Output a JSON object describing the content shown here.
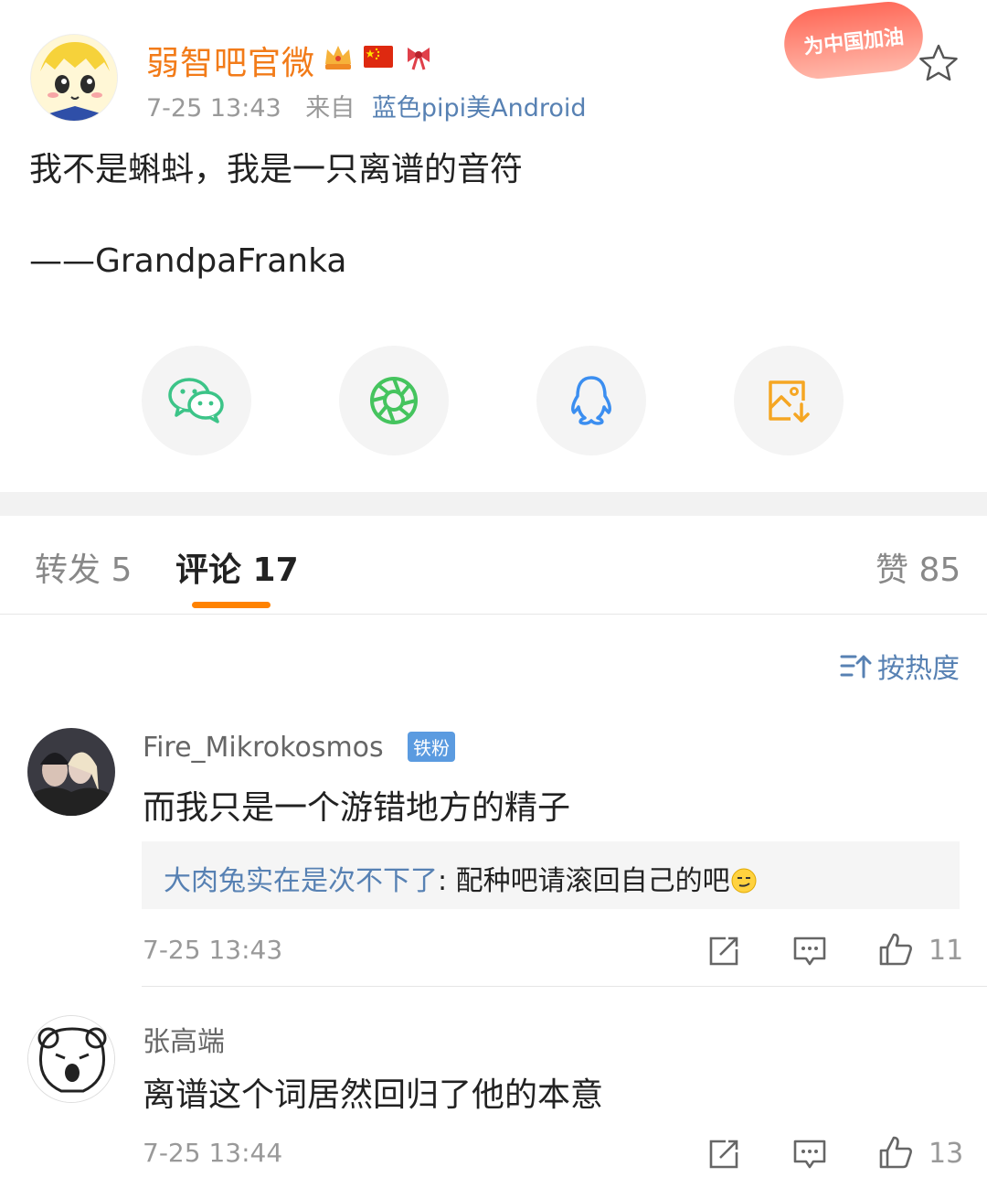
{
  "post": {
    "author": "弱智吧官微",
    "time": "7-25 13:43",
    "from_label": "来自",
    "source": "蓝色pipi美Android",
    "promo": "为中国加油",
    "text": "我不是蝌蚪，我是一只离谱的音符",
    "credit": "——GrandpaFranka"
  },
  "share": [
    "wechat-icon",
    "moments-icon",
    "qq-icon",
    "save-image-icon"
  ],
  "tabs": {
    "repost": "转发 5",
    "comments": "评论 17",
    "likes": "赞 85"
  },
  "sort": {
    "label": "按热度"
  },
  "comments": [
    {
      "name": "Fire_Mikrokosmos",
      "tag": "铁粉",
      "text": "而我只是一个游错地方的精子",
      "reply_name": "大肉兔实在是次不下了",
      "reply_text": ": 配种吧请滚回自己的吧",
      "time": "7-25 13:43",
      "likes": "11"
    },
    {
      "name": "张高端",
      "text": "离谱这个词居然回归了他的本意",
      "time": "7-25 13:44",
      "likes": "13"
    }
  ],
  "colors": {
    "author": "#f27b19",
    "link": "#5781b3",
    "accent": "#ff8200"
  }
}
